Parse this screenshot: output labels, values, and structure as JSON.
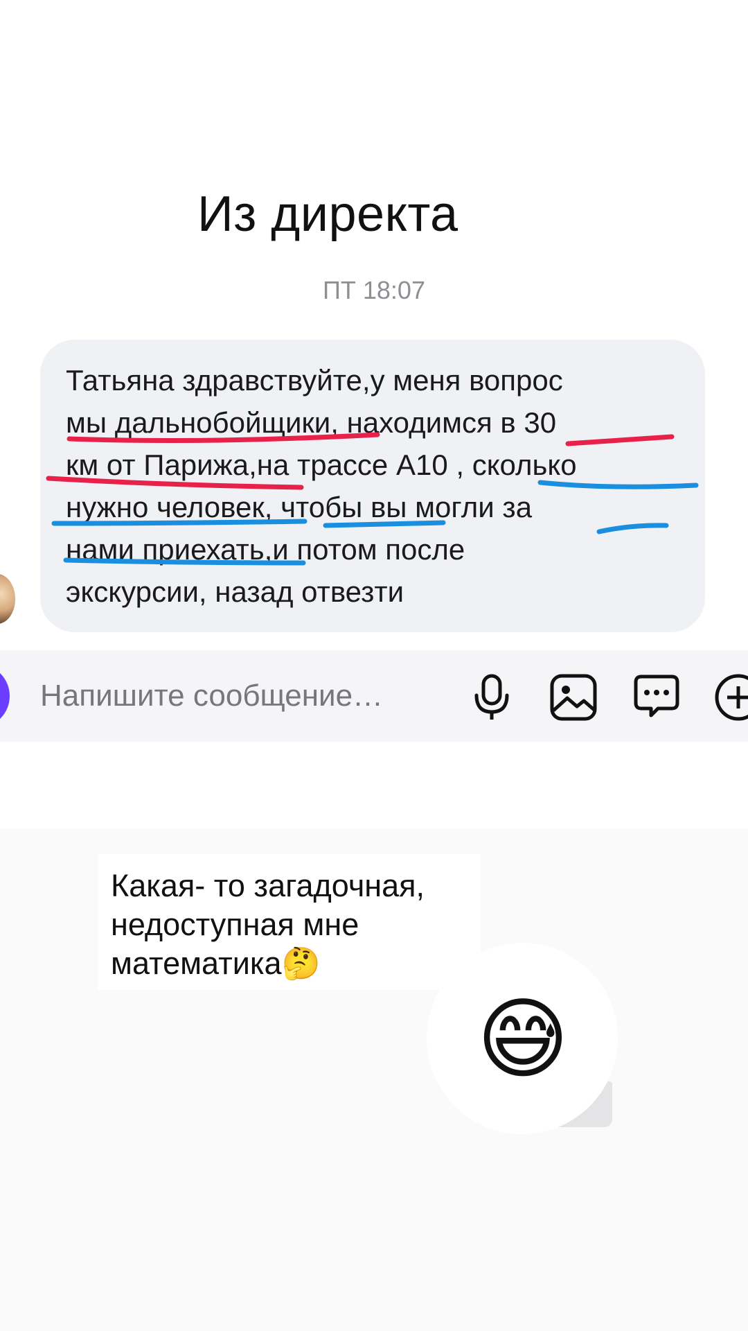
{
  "header": {
    "title": "Из директа"
  },
  "chat": {
    "timestamp": "ПТ 18:07",
    "message_text": "Татьяна здравствуйте,у меня вопрос\nмы дальнобойщики, находимся в 30\nкм от Парижа,на трассе А10 , сколько\nнужно человек, чтобы вы могли за\nнами приехать,и потом после\nэкскурсии, назад отвезти"
  },
  "composer": {
    "placeholder": "Напишите сообщение…",
    "icons": [
      "microphone-icon",
      "image-icon",
      "chat-bubble-icon",
      "plus-icon"
    ]
  },
  "caption": {
    "text": "Какая- то загадочная,\nнедоступная мне\nматематика🤔"
  },
  "sticker": {
    "emoji": "😅"
  },
  "colors": {
    "bubble_bg": "#eff1f5",
    "red_underline": "#e8214a",
    "blue_underline": "#1a8fe0",
    "input_bar_bg": "#f5f5f7",
    "composer_accent": "#6b3dff"
  }
}
